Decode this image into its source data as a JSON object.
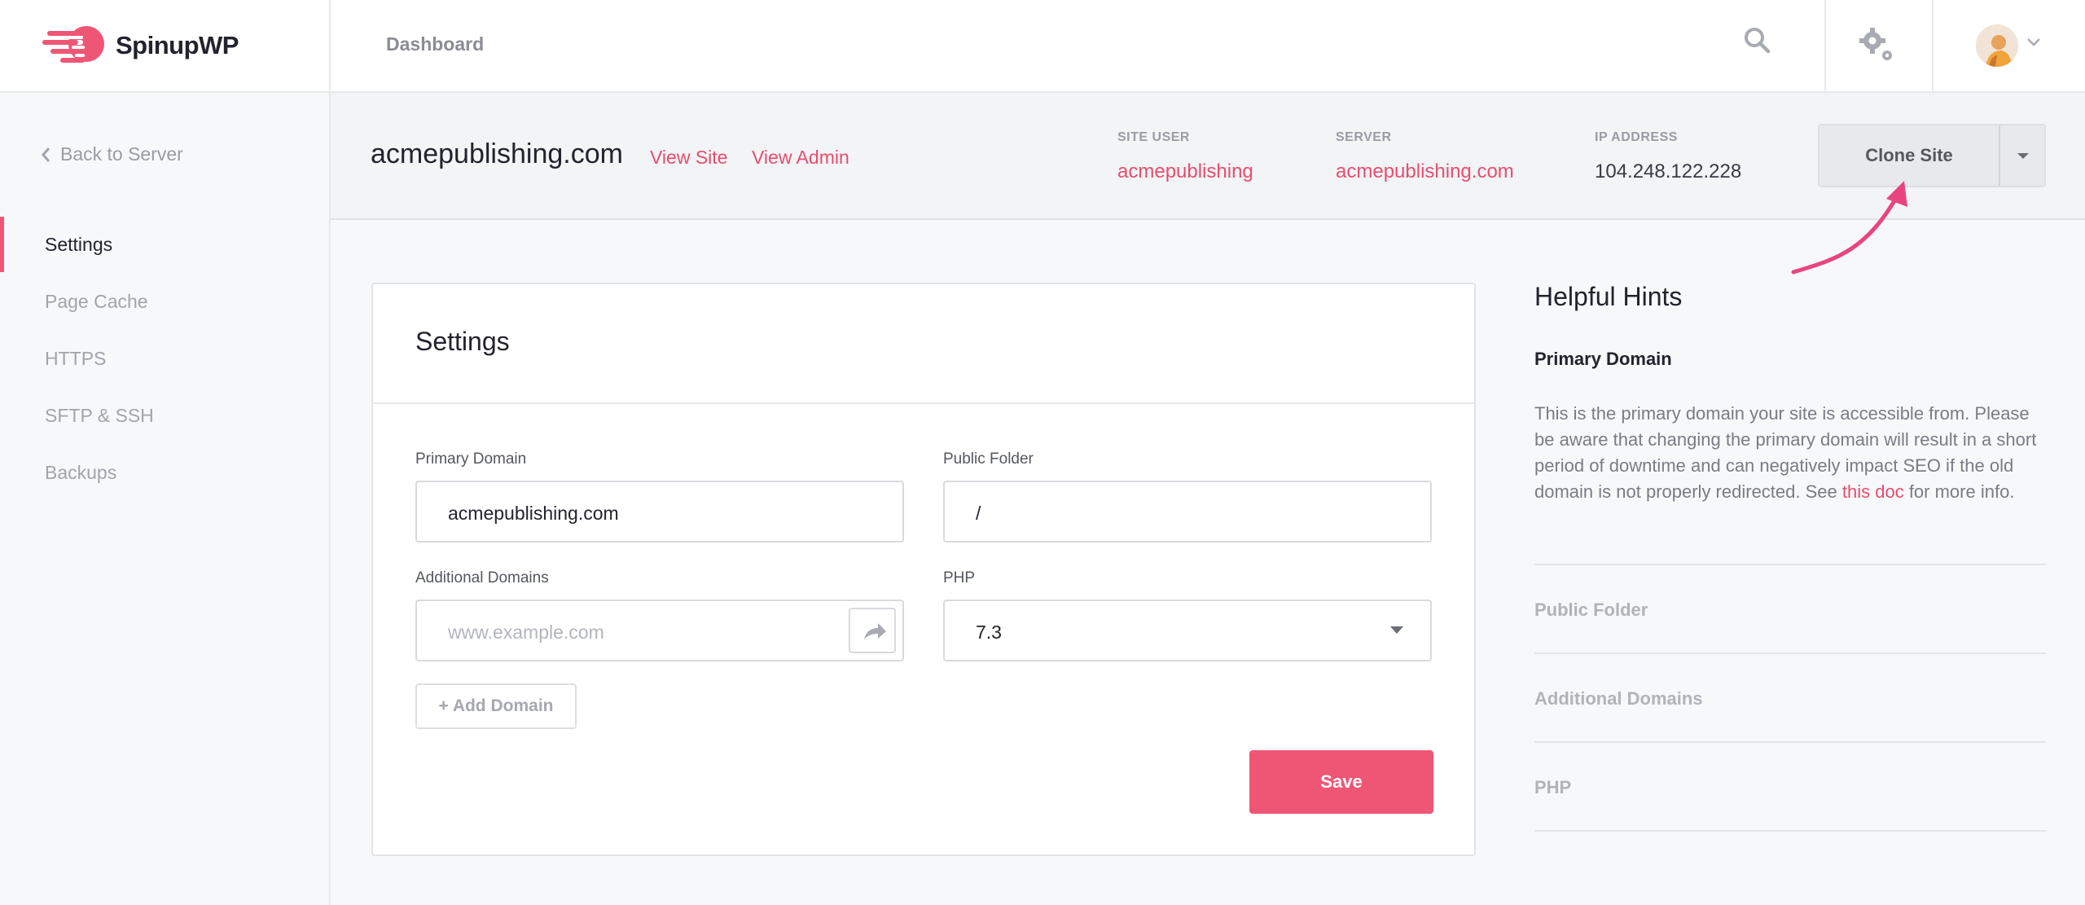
{
  "brand": {
    "name": "SpinupWP"
  },
  "topbar": {
    "nav_label": "Dashboard"
  },
  "sidebar": {
    "back_label": "Back to Server",
    "items": [
      {
        "label": "Settings",
        "active": true
      },
      {
        "label": "Page Cache"
      },
      {
        "label": "HTTPS"
      },
      {
        "label": "SFTP & SSH"
      },
      {
        "label": "Backups"
      }
    ]
  },
  "site": {
    "title": "acmepublishing.com",
    "view_site": "View Site",
    "view_admin": "View Admin",
    "site_user_label": "SITE USER",
    "site_user": "acmepublishing",
    "server_label": "SERVER",
    "server": "acmepublishing.com",
    "ip_label": "IP ADDRESS",
    "ip": "104.248.122.228",
    "clone_label": "Clone Site"
  },
  "settings": {
    "title": "Settings",
    "primary_domain_label": "Primary Domain",
    "primary_domain_value": "acmepublishing.com",
    "public_folder_label": "Public Folder",
    "public_folder_value": "/",
    "additional_domains_label": "Additional Domains",
    "additional_domains_placeholder": "www.example.com",
    "php_label": "PHP",
    "php_value": "7.3",
    "add_domain_label": "+ Add Domain",
    "save_label": "Save"
  },
  "hints": {
    "title": "Helpful Hints",
    "active_title": "Primary Domain",
    "active_body_before": "This is the primary domain your site is accessible from. Please be aware that changing the primary domain will result in a short period of downtime and can negatively impact SEO if the old domain is not properly redirected. See ",
    "active_link": "this doc",
    "active_body_after": " for more info.",
    "items": [
      "Public Folder",
      "Additional Domains",
      "PHP"
    ]
  },
  "colors": {
    "accent": "#ef5675",
    "link": "#e84d6e"
  },
  "icons": [
    "spinupwp-logo-icon",
    "search-icon",
    "gear-icon",
    "avatar",
    "chevron-down-icon",
    "chevron-left-icon",
    "share-arrow-icon",
    "caret-down-icon"
  ]
}
